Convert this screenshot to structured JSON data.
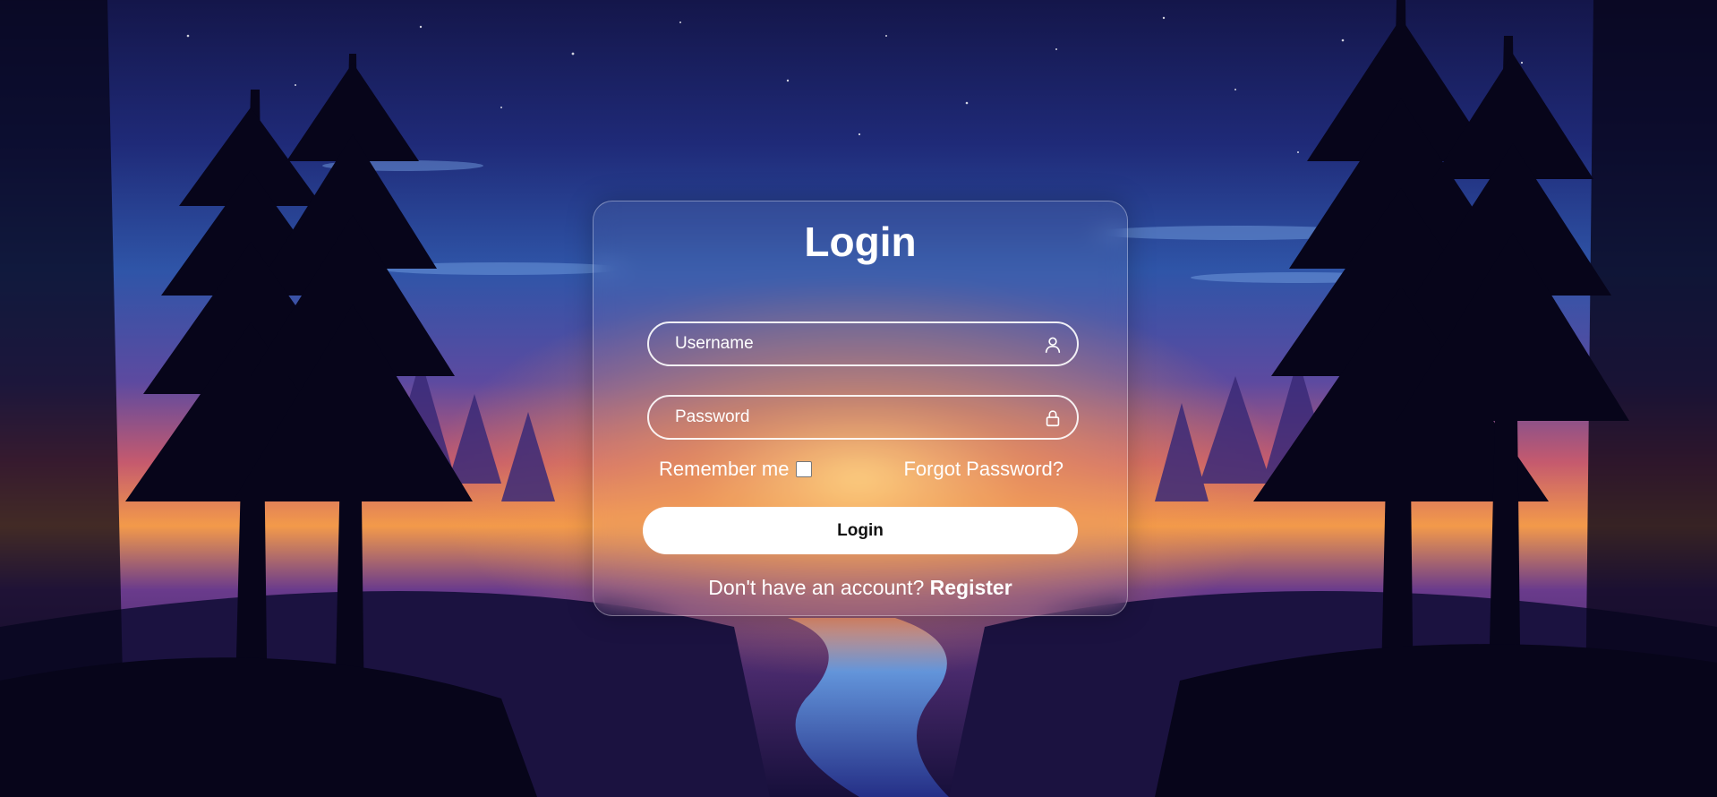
{
  "login_form": {
    "title": "Login",
    "username": {
      "value": "",
      "placeholder": "Username",
      "icon": "user-icon"
    },
    "password": {
      "value": "",
      "placeholder": "Password",
      "icon": "lock-icon"
    },
    "remember_label": "Remember me",
    "remember_checked": false,
    "forgot_label": "Forgot Password?",
    "submit_label": "Login",
    "register_prompt": "Don't have an account?",
    "register_label": "Register"
  },
  "colors": {
    "text": "#ffffff",
    "button_background": "#ffffff",
    "button_text": "#111111",
    "card_border": "rgba(255,255,255,0.35)"
  },
  "background": {
    "icon": "forest-night-landscape"
  }
}
